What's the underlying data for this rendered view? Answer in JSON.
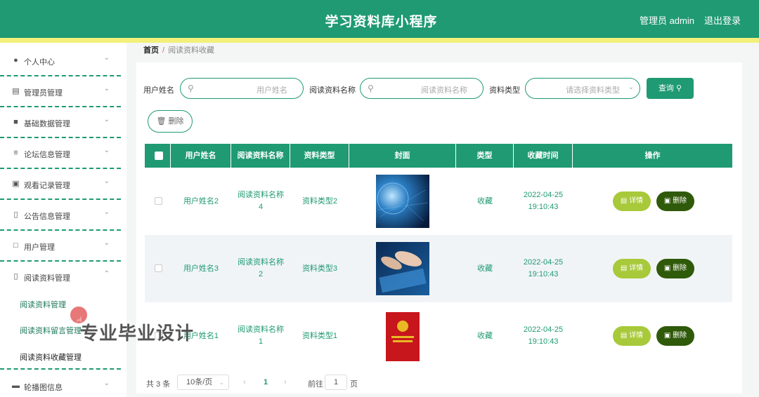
{
  "header": {
    "title": "学习资料库小程序",
    "user": "管理员 admin",
    "logout": "退出登录"
  },
  "sidebar": {
    "items": [
      {
        "label": "个人中心",
        "icon": "user-icon"
      },
      {
        "label": "管理员管理",
        "icon": "chart-icon"
      },
      {
        "label": "基础数据管理",
        "icon": "comment-icon"
      },
      {
        "label": "论坛信息管理",
        "icon": "sliders-icon"
      },
      {
        "label": "观看记录管理",
        "icon": "briefcase-icon"
      },
      {
        "label": "公告信息管理",
        "icon": "clipboard-icon"
      },
      {
        "label": "用户管理",
        "icon": "frame-icon"
      },
      {
        "label": "阅读资料管理",
        "icon": "clipboard-icon"
      },
      {
        "label": "轮播图信息",
        "icon": "monitor-icon"
      }
    ],
    "sub_items": [
      "阅读资料管理",
      "阅读资料留言管理",
      "阅读资料收藏管理"
    ]
  },
  "breadcrumb": {
    "home": "首页",
    "current": "阅读资料收藏"
  },
  "filters": {
    "username_label": "用户姓名",
    "username_placeholder": "用户姓名",
    "material_label": "阅读资料名称",
    "material_placeholder": "阅读资料名称",
    "type_label": "资料类型",
    "type_placeholder": "请选择资料类型",
    "query_button": "查询",
    "delete_button": "删除"
  },
  "table": {
    "columns": [
      "用户姓名",
      "阅读资料名称",
      "资料类型",
      "封面",
      "类型",
      "收藏时间",
      "操作"
    ],
    "rows": [
      {
        "user": "用户姓名2",
        "material": "阅读资料名称4",
        "mtype": "资料类型2",
        "kind": "收藏",
        "date": "2022-04-25",
        "time": "19:10:43"
      },
      {
        "user": "用户姓名3",
        "material": "阅读资料名称2",
        "mtype": "资料类型3",
        "kind": "收藏",
        "date": "2022-04-25",
        "time": "19:10:43"
      },
      {
        "user": "用户姓名1",
        "material": "阅读资料名称1",
        "mtype": "资料类型1",
        "kind": "收藏",
        "date": "2022-04-25",
        "time": "19:10:43"
      }
    ],
    "detail_button": "详情",
    "delete_button": "删除"
  },
  "pagination": {
    "total": "共 3 条",
    "page_size": "10条/页",
    "current_page": "1",
    "goto_label": "前往",
    "goto_value": "1",
    "page_unit": "页"
  },
  "watermark": "专业毕业设计",
  "colors": {
    "primary": "#1f9a72",
    "accent_yellow": "#f2f07b",
    "detail": "#a8c93a",
    "delete": "#2f5a0a"
  }
}
